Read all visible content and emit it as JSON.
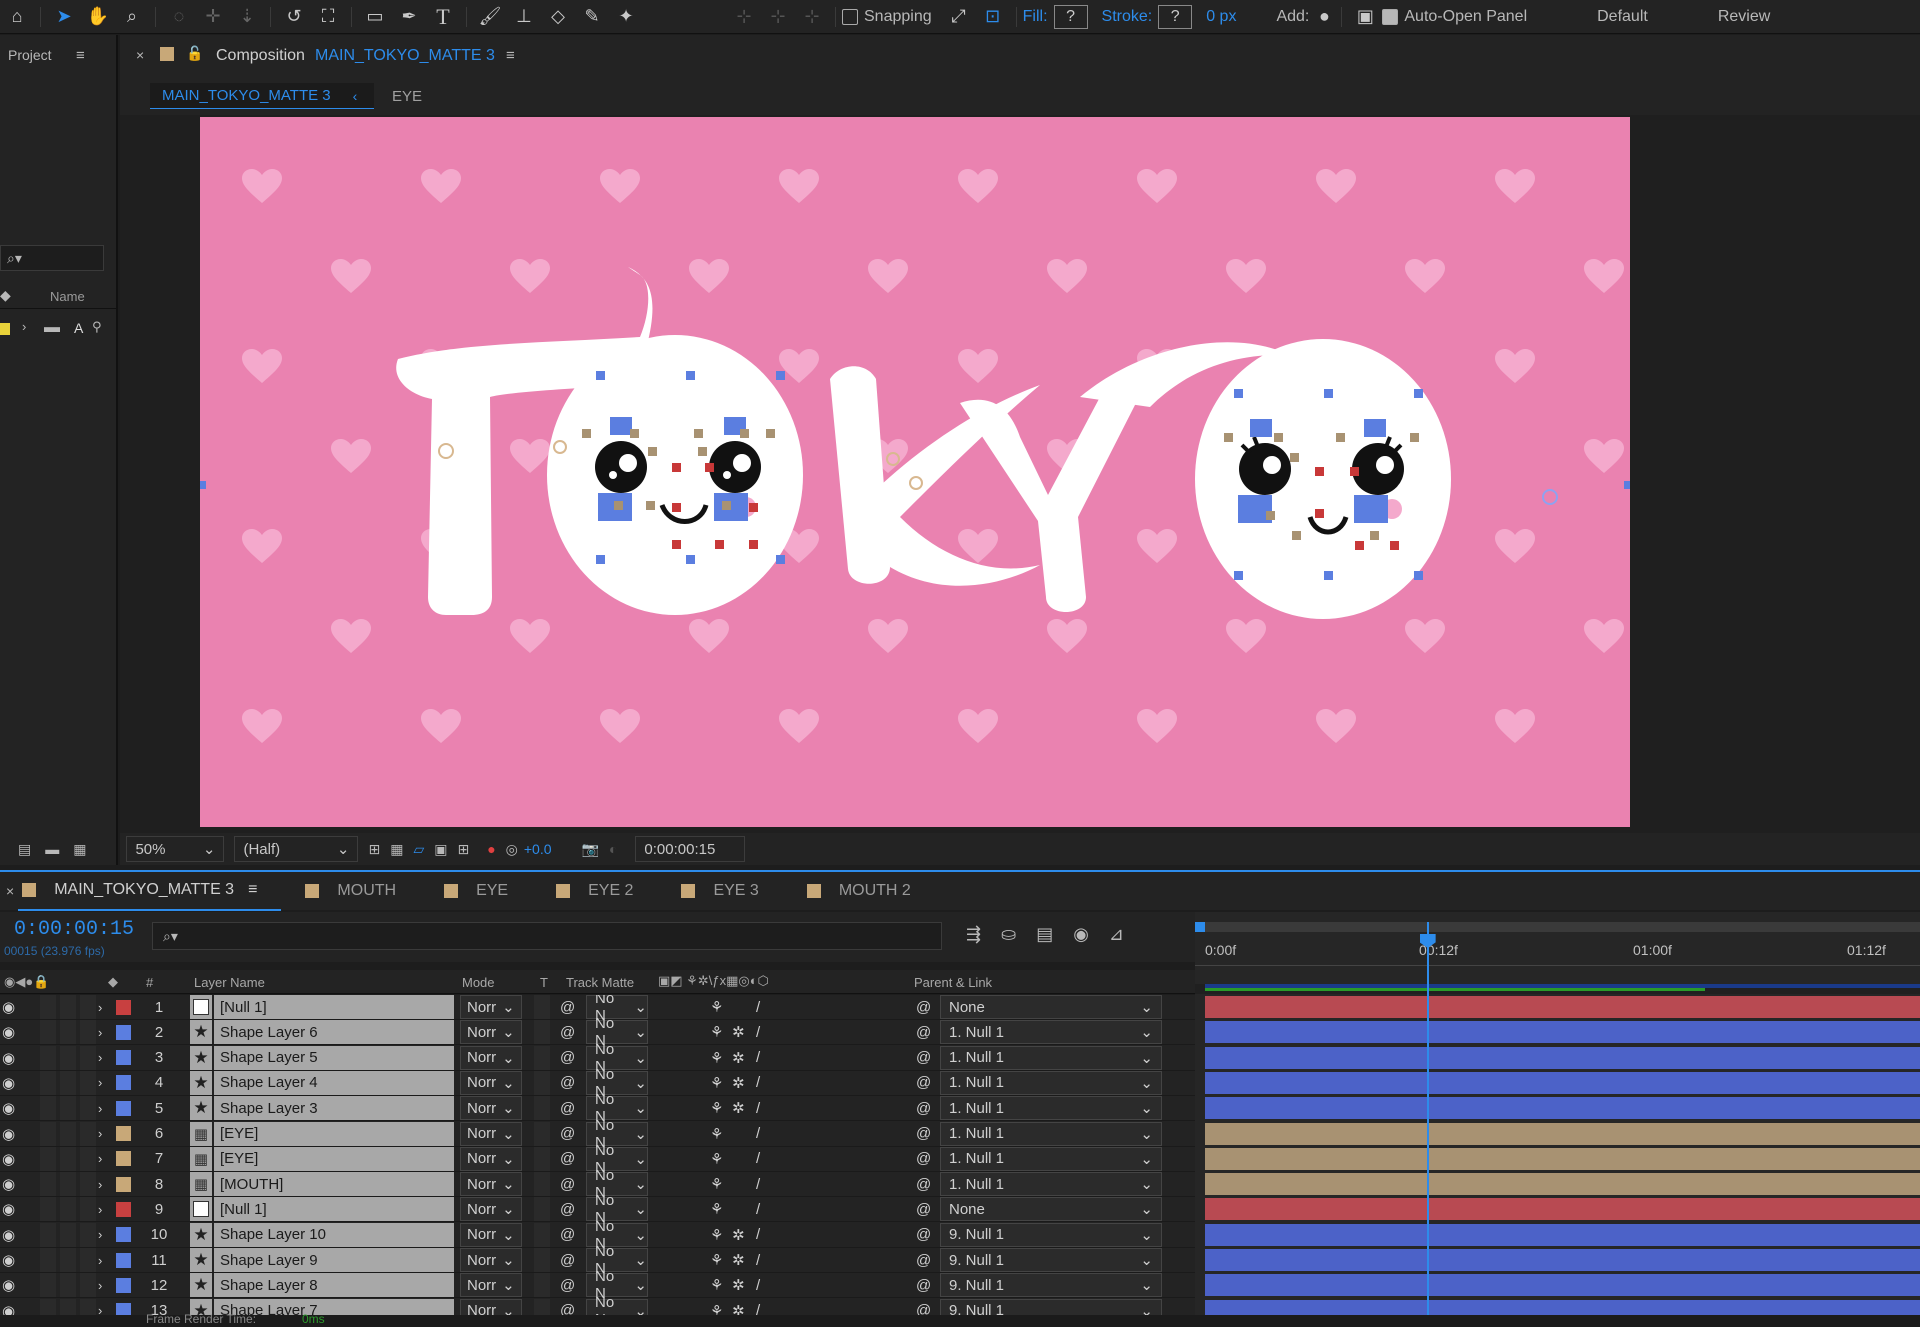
{
  "toolbar": {
    "snapping_label": "Snapping",
    "fill_label": "Fill:",
    "fill_value": "?",
    "stroke_label": "Stroke:",
    "stroke_value": "?",
    "stroke_width": "0 px",
    "add_label": "Add:",
    "auto_open_label": "Auto-Open Panel",
    "workspace_default": "Default",
    "workspace_review": "Review"
  },
  "project": {
    "title": "Project",
    "name_col": "Name",
    "item_label": "A"
  },
  "composition": {
    "panel_label": "Composition",
    "comp_name": "MAIN_TOKYO_MATTE 3",
    "breadcrumb_active": "MAIN_TOKYO_MATTE 3",
    "breadcrumb_other": "EYE",
    "canvas_text": "TOKYO",
    "footer": {
      "zoom": "50%",
      "resolution": "(Half)",
      "exposure": "+0.0",
      "timecode": "0:00:00:15"
    }
  },
  "timeline": {
    "tabs": [
      {
        "label": "MAIN_TOKYO_MATTE 3",
        "color": "#c8a878",
        "active": true
      },
      {
        "label": "MOUTH",
        "color": "#c8a878"
      },
      {
        "label": "EYE",
        "color": "#c8a878"
      },
      {
        "label": "EYE 2",
        "color": "#c8a878"
      },
      {
        "label": "EYE 3",
        "color": "#c8a878"
      },
      {
        "label": "MOUTH 2",
        "color": "#c8a878"
      }
    ],
    "current_time": "0:00:00:15",
    "frame_info": "00015 (23.976 fps)",
    "columns": {
      "layer_name": "Layer Name",
      "mode": "Mode",
      "t": "T",
      "track_matte": "Track Matte",
      "parent": "Parent & Link",
      "hash": "#"
    },
    "ruler": [
      "0:00f",
      "00:12f",
      "01:00f",
      "01:12f"
    ],
    "layers": [
      {
        "num": "1",
        "name": "[Null 1]",
        "color": "#c84040",
        "type": "null",
        "mode": "Norr",
        "tm": "No N",
        "parent": "None"
      },
      {
        "num": "2",
        "name": "Shape Layer 6",
        "color": "#5b7ee0",
        "type": "shape",
        "mode": "Norr",
        "tm": "No N",
        "parent": "1. Null 1"
      },
      {
        "num": "3",
        "name": "Shape Layer 5",
        "color": "#5b7ee0",
        "type": "shape",
        "mode": "Norr",
        "tm": "No N",
        "parent": "1. Null 1"
      },
      {
        "num": "4",
        "name": "Shape Layer 4",
        "color": "#5b7ee0",
        "type": "shape",
        "mode": "Norr",
        "tm": "No N",
        "parent": "1. Null 1"
      },
      {
        "num": "5",
        "name": "Shape Layer 3",
        "color": "#5b7ee0",
        "type": "shape",
        "mode": "Norr",
        "tm": "No N",
        "parent": "1. Null 1"
      },
      {
        "num": "6",
        "name": "[EYE]",
        "color": "#c8a878",
        "type": "comp",
        "mode": "Norr",
        "tm": "No N",
        "parent": "1. Null 1"
      },
      {
        "num": "7",
        "name": "[EYE]",
        "color": "#c8a878",
        "type": "comp",
        "mode": "Norr",
        "tm": "No N",
        "parent": "1. Null 1"
      },
      {
        "num": "8",
        "name": "[MOUTH]",
        "color": "#c8a878",
        "type": "comp",
        "mode": "Norr",
        "tm": "No N",
        "parent": "1. Null 1"
      },
      {
        "num": "9",
        "name": "[Null 1]",
        "color": "#c84040",
        "type": "null",
        "mode": "Norr",
        "tm": "No N",
        "parent": "None"
      },
      {
        "num": "10",
        "name": "Shape Layer 10",
        "color": "#5b7ee0",
        "type": "shape",
        "mode": "Norr",
        "tm": "No N",
        "parent": "9. Null 1"
      },
      {
        "num": "11",
        "name": "Shape Layer 9",
        "color": "#5b7ee0",
        "type": "shape",
        "mode": "Norr",
        "tm": "No N",
        "parent": "9. Null 1"
      },
      {
        "num": "12",
        "name": "Shape Layer 8",
        "color": "#5b7ee0",
        "type": "shape",
        "mode": "Norr",
        "tm": "No N",
        "parent": "9. Null 1"
      },
      {
        "num": "13",
        "name": "Shape Layer 7",
        "color": "#5b7ee0",
        "type": "shape",
        "mode": "Norr",
        "tm": "No N",
        "parent": "9. Null 1"
      }
    ],
    "bar_colors": {
      "null": "#b84a52",
      "shape": "#4c62c8",
      "comp": "#a89272"
    },
    "playhead_fraction": 0.31
  },
  "status": {
    "render_label": "Frame Render Time:",
    "render_value": "0ms"
  },
  "colors": {
    "accent": "#2d8ceb",
    "canvas_pink": "#ea82b0",
    "heart_pink": "#f4a9cc"
  }
}
